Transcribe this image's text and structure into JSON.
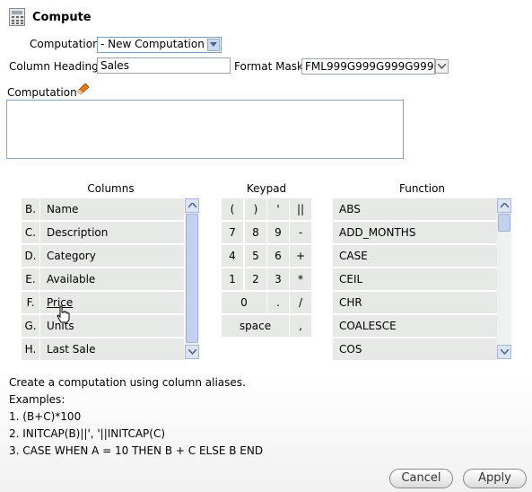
{
  "header": {
    "title": "Compute",
    "icon": "calculator-icon"
  },
  "form": {
    "computation_label": "Computation",
    "computation_select": "- New Computation -",
    "column_heading_label": "Column Heading",
    "column_heading_value": "Sales",
    "format_mask_label": "Format Mask",
    "format_mask_value": "FML999G999G999G999G",
    "computation_expr_label": "Computation",
    "computation_expr_value": ""
  },
  "columns": {
    "heading": "Columns",
    "items": [
      {
        "alias": "B.",
        "name": "Name"
      },
      {
        "alias": "C.",
        "name": "Description"
      },
      {
        "alias": "D.",
        "name": "Category"
      },
      {
        "alias": "E.",
        "name": "Available"
      },
      {
        "alias": "F.",
        "name": "Price"
      },
      {
        "alias": "G.",
        "name": "Units"
      },
      {
        "alias": "H.",
        "name": "Last Sale"
      }
    ]
  },
  "keypad": {
    "heading": "Keypad",
    "keys": [
      "(",
      ")",
      "'",
      "||",
      "7",
      "8",
      "9",
      "-",
      "4",
      "5",
      "6",
      "+",
      "1",
      "2",
      "3",
      "*",
      "0",
      ".",
      "/",
      "space",
      ","
    ]
  },
  "functions": {
    "heading": "Function",
    "items": [
      "ABS",
      "ADD_MONTHS",
      "CASE",
      "CEIL",
      "CHR",
      "COALESCE",
      "COS"
    ]
  },
  "help": {
    "intro": "Create a computation using column aliases.",
    "examples_label": "Examples:",
    "examples": [
      "1. (B+C)*100",
      "2. INITCAP(B)||', '||INITCAP(C)",
      "3. CASE WHEN A = 10 THEN B + C ELSE B END"
    ]
  },
  "buttons": {
    "cancel": "Cancel",
    "apply": "Apply"
  },
  "colors": {
    "cell_bg": "#e6e9e6",
    "scrollbar_thumb": "#c3d1ee",
    "select_border": "#7f9db9"
  }
}
